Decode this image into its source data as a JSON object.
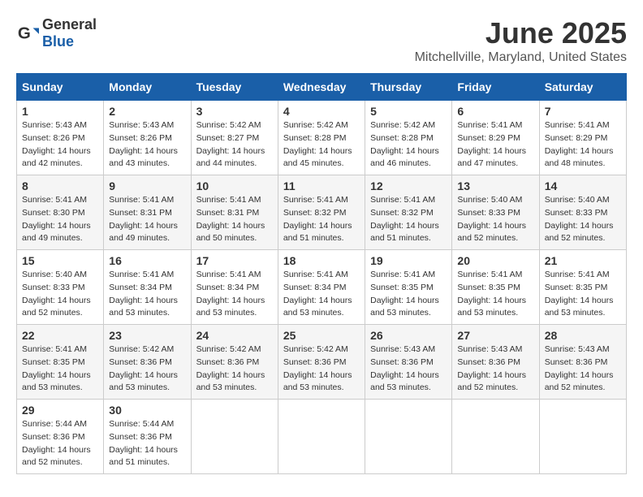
{
  "header": {
    "logo_general": "General",
    "logo_blue": "Blue",
    "month": "June 2025",
    "location": "Mitchellville, Maryland, United States"
  },
  "weekdays": [
    "Sunday",
    "Monday",
    "Tuesday",
    "Wednesday",
    "Thursday",
    "Friday",
    "Saturday"
  ],
  "weeks": [
    [
      {
        "day": "1",
        "sunrise": "5:43 AM",
        "sunset": "8:26 PM",
        "daylight": "14 hours and 42 minutes."
      },
      {
        "day": "2",
        "sunrise": "5:43 AM",
        "sunset": "8:26 PM",
        "daylight": "14 hours and 43 minutes."
      },
      {
        "day": "3",
        "sunrise": "5:42 AM",
        "sunset": "8:27 PM",
        "daylight": "14 hours and 44 minutes."
      },
      {
        "day": "4",
        "sunrise": "5:42 AM",
        "sunset": "8:28 PM",
        "daylight": "14 hours and 45 minutes."
      },
      {
        "day": "5",
        "sunrise": "5:42 AM",
        "sunset": "8:28 PM",
        "daylight": "14 hours and 46 minutes."
      },
      {
        "day": "6",
        "sunrise": "5:41 AM",
        "sunset": "8:29 PM",
        "daylight": "14 hours and 47 minutes."
      },
      {
        "day": "7",
        "sunrise": "5:41 AM",
        "sunset": "8:29 PM",
        "daylight": "14 hours and 48 minutes."
      }
    ],
    [
      {
        "day": "8",
        "sunrise": "5:41 AM",
        "sunset": "8:30 PM",
        "daylight": "14 hours and 49 minutes."
      },
      {
        "day": "9",
        "sunrise": "5:41 AM",
        "sunset": "8:31 PM",
        "daylight": "14 hours and 49 minutes."
      },
      {
        "day": "10",
        "sunrise": "5:41 AM",
        "sunset": "8:31 PM",
        "daylight": "14 hours and 50 minutes."
      },
      {
        "day": "11",
        "sunrise": "5:41 AM",
        "sunset": "8:32 PM",
        "daylight": "14 hours and 51 minutes."
      },
      {
        "day": "12",
        "sunrise": "5:41 AM",
        "sunset": "8:32 PM",
        "daylight": "14 hours and 51 minutes."
      },
      {
        "day": "13",
        "sunrise": "5:40 AM",
        "sunset": "8:33 PM",
        "daylight": "14 hours and 52 minutes."
      },
      {
        "day": "14",
        "sunrise": "5:40 AM",
        "sunset": "8:33 PM",
        "daylight": "14 hours and 52 minutes."
      }
    ],
    [
      {
        "day": "15",
        "sunrise": "5:40 AM",
        "sunset": "8:33 PM",
        "daylight": "14 hours and 52 minutes."
      },
      {
        "day": "16",
        "sunrise": "5:41 AM",
        "sunset": "8:34 PM",
        "daylight": "14 hours and 53 minutes."
      },
      {
        "day": "17",
        "sunrise": "5:41 AM",
        "sunset": "8:34 PM",
        "daylight": "14 hours and 53 minutes."
      },
      {
        "day": "18",
        "sunrise": "5:41 AM",
        "sunset": "8:34 PM",
        "daylight": "14 hours and 53 minutes."
      },
      {
        "day": "19",
        "sunrise": "5:41 AM",
        "sunset": "8:35 PM",
        "daylight": "14 hours and 53 minutes."
      },
      {
        "day": "20",
        "sunrise": "5:41 AM",
        "sunset": "8:35 PM",
        "daylight": "14 hours and 53 minutes."
      },
      {
        "day": "21",
        "sunrise": "5:41 AM",
        "sunset": "8:35 PM",
        "daylight": "14 hours and 53 minutes."
      }
    ],
    [
      {
        "day": "22",
        "sunrise": "5:41 AM",
        "sunset": "8:35 PM",
        "daylight": "14 hours and 53 minutes."
      },
      {
        "day": "23",
        "sunrise": "5:42 AM",
        "sunset": "8:36 PM",
        "daylight": "14 hours and 53 minutes."
      },
      {
        "day": "24",
        "sunrise": "5:42 AM",
        "sunset": "8:36 PM",
        "daylight": "14 hours and 53 minutes."
      },
      {
        "day": "25",
        "sunrise": "5:42 AM",
        "sunset": "8:36 PM",
        "daylight": "14 hours and 53 minutes."
      },
      {
        "day": "26",
        "sunrise": "5:43 AM",
        "sunset": "8:36 PM",
        "daylight": "14 hours and 53 minutes."
      },
      {
        "day": "27",
        "sunrise": "5:43 AM",
        "sunset": "8:36 PM",
        "daylight": "14 hours and 52 minutes."
      },
      {
        "day": "28",
        "sunrise": "5:43 AM",
        "sunset": "8:36 PM",
        "daylight": "14 hours and 52 minutes."
      }
    ],
    [
      {
        "day": "29",
        "sunrise": "5:44 AM",
        "sunset": "8:36 PM",
        "daylight": "14 hours and 52 minutes."
      },
      {
        "day": "30",
        "sunrise": "5:44 AM",
        "sunset": "8:36 PM",
        "daylight": "14 hours and 51 minutes."
      },
      null,
      null,
      null,
      null,
      null
    ]
  ]
}
